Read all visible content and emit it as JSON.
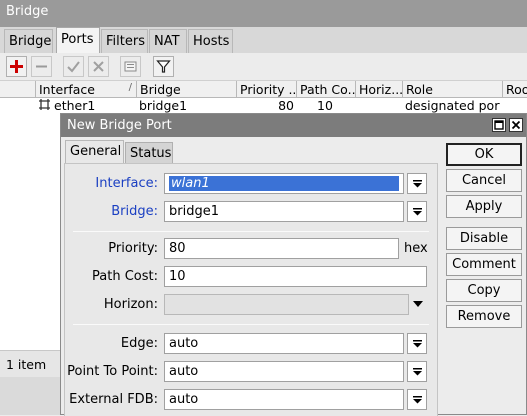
{
  "window": {
    "title": "Bridge"
  },
  "tabs": [
    {
      "label": "Bridge"
    },
    {
      "label": "Ports",
      "active": true
    },
    {
      "label": "Filters"
    },
    {
      "label": "NAT"
    },
    {
      "label": "Hosts"
    }
  ],
  "toolbar": {
    "icons": [
      "plus-icon",
      "minus-icon",
      "check-icon",
      "cross-icon",
      "comment-icon",
      "filter-icon"
    ],
    "colors": {
      "add": "#cc0000"
    }
  },
  "table": {
    "columns": [
      "Interface",
      "Bridge",
      "Priority ...",
      "Path Co...",
      "Horiz...",
      "Role",
      "Roo"
    ],
    "rows": [
      {
        "interface": "ether1",
        "bridge": "bridge1",
        "priority": "80",
        "path_cost": "10",
        "horizon": "",
        "role": "designated port",
        "root": ""
      }
    ]
  },
  "status": {
    "count_text": "1 item"
  },
  "dialog": {
    "title": "New Bridge Port",
    "tabs": [
      {
        "label": "General",
        "active": true
      },
      {
        "label": "Status"
      }
    ],
    "fields": {
      "interface": {
        "label": "Interface:",
        "value": "wlan1"
      },
      "bridge": {
        "label": "Bridge:",
        "value": "bridge1"
      },
      "priority": {
        "label": "Priority:",
        "value": "80",
        "suffix": "hex"
      },
      "path_cost": {
        "label": "Path Cost:",
        "value": "10"
      },
      "horizon": {
        "label": "Horizon:",
        "value": ""
      },
      "edge": {
        "label": "Edge:",
        "value": "auto"
      },
      "point_to_point": {
        "label": "Point To Point:",
        "value": "auto"
      },
      "external_fdb": {
        "label": "External FDB:",
        "value": "auto"
      }
    },
    "buttons": {
      "ok": "OK",
      "cancel": "Cancel",
      "apply": "Apply",
      "disable": "Disable",
      "comment": "Comment",
      "copy": "Copy",
      "remove": "Remove"
    },
    "colors": {
      "title_bar": "#7c7c7c",
      "selection": "#3b72d6",
      "link_label": "#1a3fc2"
    }
  }
}
